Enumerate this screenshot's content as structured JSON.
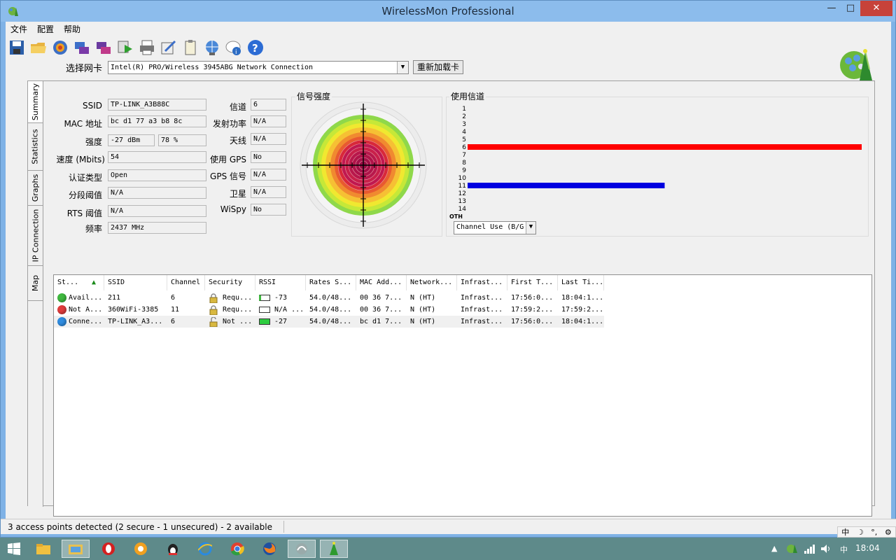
{
  "window": {
    "title": "WirelessMon Professional",
    "min": "—",
    "max": "□",
    "close": "✕"
  },
  "menu": [
    "文件",
    "配置",
    "帮助"
  ],
  "toolbar_icons": [
    "save-icon",
    "open-folder-icon",
    "globe-icon",
    "network-card-icon",
    "network-card-alt-icon",
    "play-icon",
    "print-icon",
    "wizard-icon",
    "clipboard-icon",
    "network-web-icon",
    "info-icon",
    "help-icon"
  ],
  "adapter": {
    "label": "选择网卡",
    "value": "Intel(R) PRO/Wireless 3945ABG Network Connection",
    "reload": "重新加载卡"
  },
  "tabs": [
    "Summary",
    "Statistics",
    "Graphs",
    "IP Connection",
    "Map"
  ],
  "summary": {
    "ssid_label": "SSID",
    "ssid": "TP-LINK_A3B88C",
    "mac_label": "MAC 地址",
    "mac": "bc d1 77 a3 b8 8c",
    "strength_label": "强度",
    "strength_dbm": "-27 dBm",
    "strength_pct": "78 %",
    "speed_label": "速度 (Mbits)",
    "speed": "54",
    "auth_label": "认证类型",
    "auth": "Open",
    "frag_label": "分段阈值",
    "frag": "N/A",
    "rts_label": "RTS 阈值",
    "rts": "N/A",
    "freq_label": "频率",
    "freq": "2437 MHz",
    "channel_label": "信道",
    "channel": "6",
    "txpower_label": "发射功率",
    "txpower": "N/A",
    "antenna_label": "天线",
    "antenna": "N/A",
    "gps_label": "使用 GPS",
    "gps": "No",
    "gps_signal_label": "GPS 信号",
    "gps_signal": "N/A",
    "sat_label": "卫星",
    "sat": "N/A",
    "wispy_label": "WiSpy",
    "wispy": "No"
  },
  "signal": {
    "title": "信号强度",
    "level_pct": 78
  },
  "channel_use": {
    "title": "使用信道",
    "labels": [
      "1",
      "2",
      "3",
      "4",
      "5",
      "6",
      "7",
      "8",
      "9",
      "10",
      "11",
      "12",
      "13",
      "14",
      "OTH"
    ],
    "bars": [
      {
        "channel": "6",
        "fraction": 1.0,
        "color": "#ff0000"
      },
      {
        "channel": "11",
        "fraction": 0.5,
        "color": "#0000e0"
      }
    ],
    "mode": "Channel Use (B/G"
  },
  "columns": [
    "St...",
    "SSID",
    "Channel",
    "Security",
    "RSSI",
    "Rates S...",
    "MAC Add...",
    "Network...",
    "Infrast...",
    "First T...",
    "Last Ti..."
  ],
  "rows": [
    {
      "status": "Avail...",
      "status_color": "#3fb83f",
      "ssid": "211",
      "channel": "6",
      "security": "Requ...",
      "lock": "locked",
      "rssi": "-73",
      "rssi_fill": "#ffffff",
      "rssi_mark": "#3fb83f",
      "rates": "54.0/48...",
      "mac": "00 36 7...",
      "network": "N (HT)",
      "infra": "Infrast...",
      "first": "17:56:0...",
      "last": "18:04:1..."
    },
    {
      "status": "Not A...",
      "status_color": "#e03c3c",
      "ssid": "360WiFi-3385",
      "channel": "11",
      "security": "Requ...",
      "lock": "locked",
      "rssi": "N/A ...",
      "rssi_fill": "#ffffff",
      "rssi_mark": "",
      "rates": "54.0/48...",
      "mac": "00 36 7...",
      "network": "N (HT)",
      "infra": "Infrast...",
      "first": "17:59:2...",
      "last": "17:59:2..."
    },
    {
      "status": "Conne...",
      "status_color": "#2f8ce0",
      "ssid": "TP-LINK_A3...",
      "channel": "6",
      "security": "Not ...",
      "lock": "unlocked",
      "rssi": "-27",
      "rssi_fill": "#2ecc40",
      "rssi_mark": "",
      "rates": "54.0/48...",
      "mac": "bc d1 7...",
      "network": "N (HT)",
      "infra": "Infrast...",
      "first": "17:56:0...",
      "last": "18:04:1..."
    }
  ],
  "status": "3 access points detected (2 secure - 1 unsecured) - 2 available",
  "ime": [
    "中",
    "☽",
    "°,",
    "⚙"
  ],
  "taskbar": {
    "clock": "18:04",
    "lang": "中",
    "up": "▲"
  }
}
